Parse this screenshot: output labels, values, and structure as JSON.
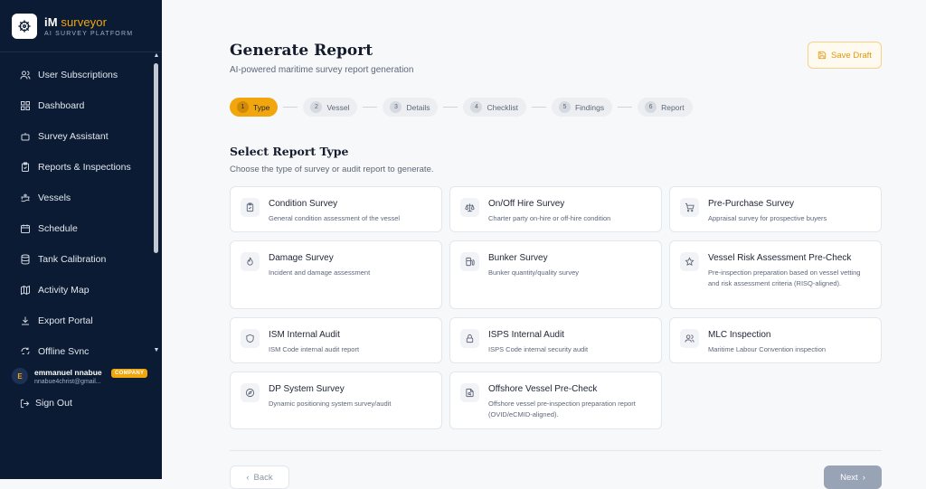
{
  "brand": {
    "name_bold": "iM",
    "name_accent": "surveyor",
    "subtitle": "AI SURVEY PLATFORM"
  },
  "sidebar": {
    "items": [
      {
        "label": "User Subscriptions",
        "icon": "users-icon"
      },
      {
        "label": "Dashboard",
        "icon": "grid-icon"
      },
      {
        "label": "Survey Assistant",
        "icon": "bot-icon"
      },
      {
        "label": "Reports & Inspections",
        "icon": "clipboard-icon"
      },
      {
        "label": "Vessels",
        "icon": "ship-icon"
      },
      {
        "label": "Schedule",
        "icon": "calendar-icon"
      },
      {
        "label": "Tank Calibration",
        "icon": "database-icon"
      },
      {
        "label": "Activity Map",
        "icon": "map-icon"
      },
      {
        "label": "Export Portal",
        "icon": "download-icon"
      },
      {
        "label": "Offline Sync",
        "icon": "refresh-icon"
      }
    ],
    "user": {
      "initial": "E",
      "name": "emmanuel nnabue",
      "email": "nnabue4christ@gmail...",
      "badge": "COMPANY"
    },
    "signout": "Sign Out"
  },
  "main": {
    "title": "Generate Report",
    "subtitle": "AI-powered maritime survey report generation",
    "save_label": "Save Draft",
    "steps": [
      {
        "num": "1",
        "label": "Type"
      },
      {
        "num": "2",
        "label": "Vessel"
      },
      {
        "num": "3",
        "label": "Details"
      },
      {
        "num": "4",
        "label": "Checklist"
      },
      {
        "num": "5",
        "label": "Findings"
      },
      {
        "num": "6",
        "label": "Report"
      }
    ],
    "section_title": "Select Report Type",
    "section_sub": "Choose the type of survey or audit report to generate.",
    "cards": [
      {
        "title": "Condition Survey",
        "desc": "General condition assessment of the vessel",
        "icon": "clipboard-check-icon"
      },
      {
        "title": "On/Off Hire Survey",
        "desc": "Charter party on-hire or off-hire condition",
        "icon": "scale-icon"
      },
      {
        "title": "Pre-Purchase Survey",
        "desc": "Appraisal survey for prospective buyers",
        "icon": "cart-icon"
      },
      {
        "title": "Damage Survey",
        "desc": "Incident and damage assessment",
        "icon": "flame-icon"
      },
      {
        "title": "Bunker Survey",
        "desc": "Bunker quantity/quality survey",
        "icon": "fuel-icon"
      },
      {
        "title": "Vessel Risk Assessment Pre-Check",
        "desc": "Pre-inspection preparation based on vessel vetting and risk assessment criteria (RISQ-aligned).",
        "icon": "star-icon"
      },
      {
        "title": "ISM Internal Audit",
        "desc": "ISM Code internal audit report",
        "icon": "shield-icon"
      },
      {
        "title": "ISPS Internal Audit",
        "desc": "ISPS Code internal security audit",
        "icon": "lock-icon"
      },
      {
        "title": "MLC Inspection",
        "desc": "Maritime Labour Convention inspection",
        "icon": "people-icon"
      },
      {
        "title": "DP System Survey",
        "desc": "Dynamic positioning system survey/audit",
        "icon": "compass-icon"
      },
      {
        "title": "Offshore Vessel Pre-Check",
        "desc": "Offshore vessel pre-inspection preparation report (OVID/eCMID-aligned).",
        "icon": "file-search-icon"
      }
    ],
    "back_label": "Back",
    "next_label": "Next"
  }
}
